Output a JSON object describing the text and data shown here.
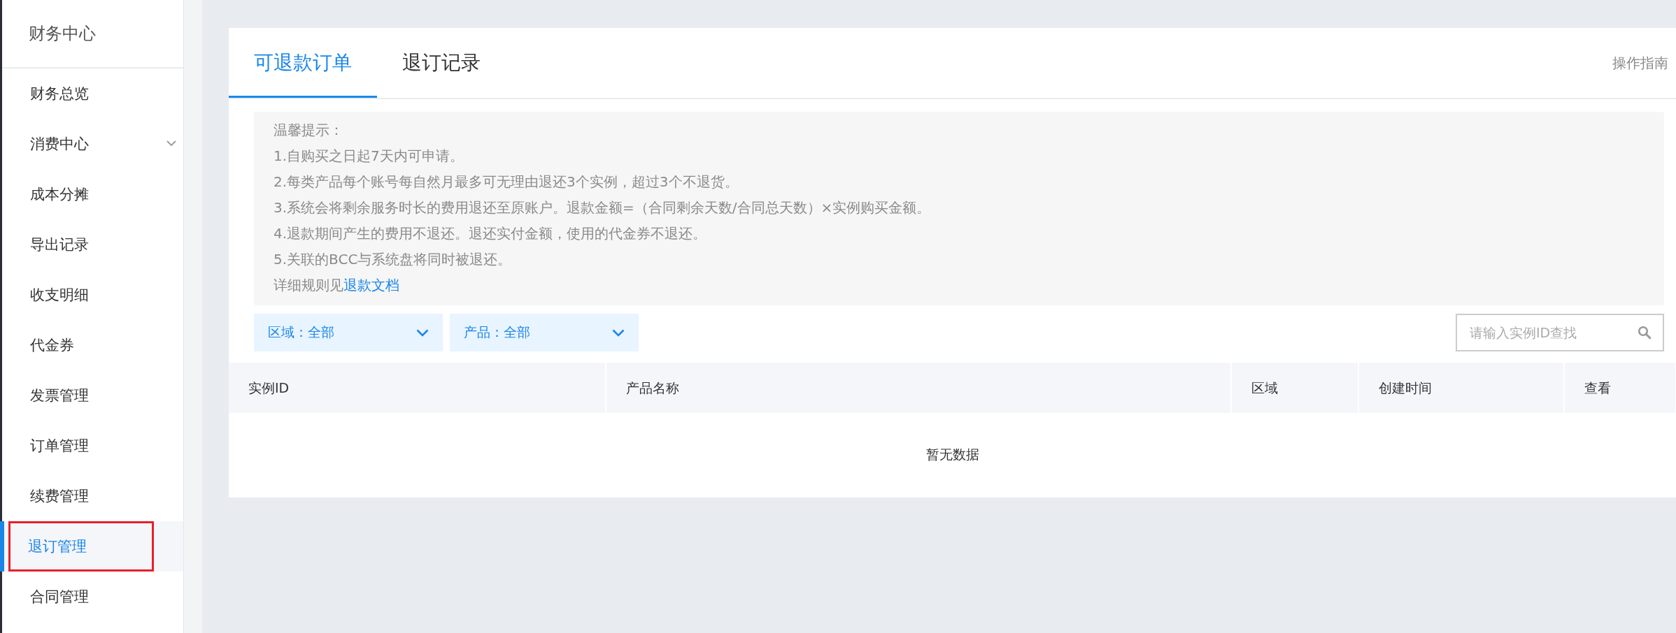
{
  "sidebar": {
    "title": "财务中心",
    "items": [
      {
        "label": "财务总览",
        "selected": false,
        "expandable": false
      },
      {
        "label": "消费中心",
        "selected": false,
        "expandable": true
      },
      {
        "label": "成本分摊",
        "selected": false,
        "expandable": false
      },
      {
        "label": "导出记录",
        "selected": false,
        "expandable": false
      },
      {
        "label": "收支明细",
        "selected": false,
        "expandable": false
      },
      {
        "label": "代金券",
        "selected": false,
        "expandable": false
      },
      {
        "label": "发票管理",
        "selected": false,
        "expandable": false
      },
      {
        "label": "订单管理",
        "selected": false,
        "expandable": false
      },
      {
        "label": "续费管理",
        "selected": false,
        "expandable": false
      },
      {
        "label": "退订管理",
        "selected": true,
        "expandable": false,
        "highlighted": true
      },
      {
        "label": "合同管理",
        "selected": false,
        "expandable": false
      }
    ]
  },
  "tabs": [
    {
      "label": "可退款订单",
      "selected": true
    },
    {
      "label": "退订记录",
      "selected": false
    }
  ],
  "guide_link": "操作指南",
  "notice": {
    "title": "温馨提示：",
    "lines": [
      "1.自购买之日起7天内可申请。",
      "2.每类产品每个账号每自然月最多可无理由退还3个实例，超过3个不退货。",
      "3.系统会将剩余服务时长的费用退还至原账户。退款金额=（合同剩余天数/合同总天数）×实例购买金额。",
      "4.退款期间产生的费用不退还。退还实付金额，使用的代金券不退还。",
      "5.关联的BCC与系统盘将同时被退还。"
    ],
    "footer": "详细规则见",
    "footer_link": "退款文档"
  },
  "filters": [
    {
      "label": "区域：全部"
    },
    {
      "label": "产品：全部"
    }
  ],
  "search": {
    "placeholder": "请输入实例ID查找"
  },
  "table": {
    "columns": [
      "实例ID",
      "产品名称",
      "区域",
      "创建时间",
      "查看"
    ],
    "empty_text": "暂无数据"
  }
}
